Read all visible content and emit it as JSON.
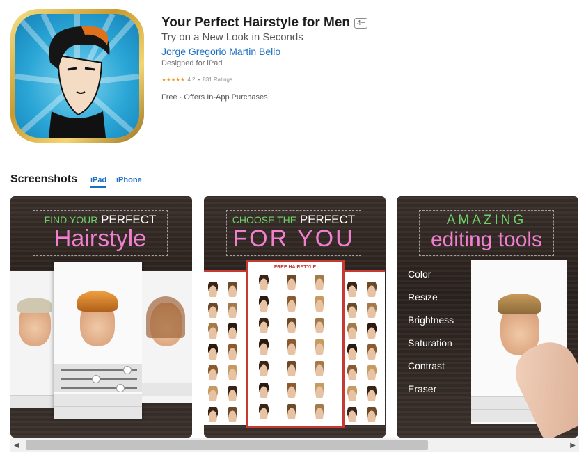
{
  "app": {
    "title": "Your Perfect Hairstyle for Men",
    "age_rating": "4+",
    "subtitle": "Try on a New Look in Seconds",
    "developer": "Jorge Gregorio Martin Bello",
    "designed_for": "Designed for iPad",
    "stars": "★★★★★",
    "rating": "4.2",
    "rating_separator": "•",
    "ratings_count": "831 Ratings",
    "price": "Free · Offers In-App Purchases"
  },
  "screenshots": {
    "heading": "Screenshots",
    "tabs": [
      {
        "label": "iPad",
        "selected": true
      },
      {
        "label": "iPhone",
        "selected": false
      }
    ],
    "cards": [
      {
        "line1_small": "FIND YOUR",
        "line1_big": "PERFECT",
        "line2": "Hairstyle"
      },
      {
        "line1_small": "CHOOSE THE",
        "line1_big": "PERFECT",
        "line2": "FOR YOU",
        "grid_title": "FREE HAIRSTYLE"
      },
      {
        "line1_small": "",
        "line1_big": "AMAZING",
        "line2": "editing tools",
        "tools": [
          "Color",
          "Resize",
          "Brightness",
          "Saturation",
          "Contrast",
          "Eraser"
        ]
      }
    ]
  },
  "scrollbar": {
    "left_arrow": "◀",
    "right_arrow": "▶",
    "position": 0.0
  },
  "colors": {
    "accent": "#1a6fc4",
    "headline_pink": "#f07fd0",
    "headline_green": "#6fd06a",
    "frame_red": "#c63a34"
  }
}
